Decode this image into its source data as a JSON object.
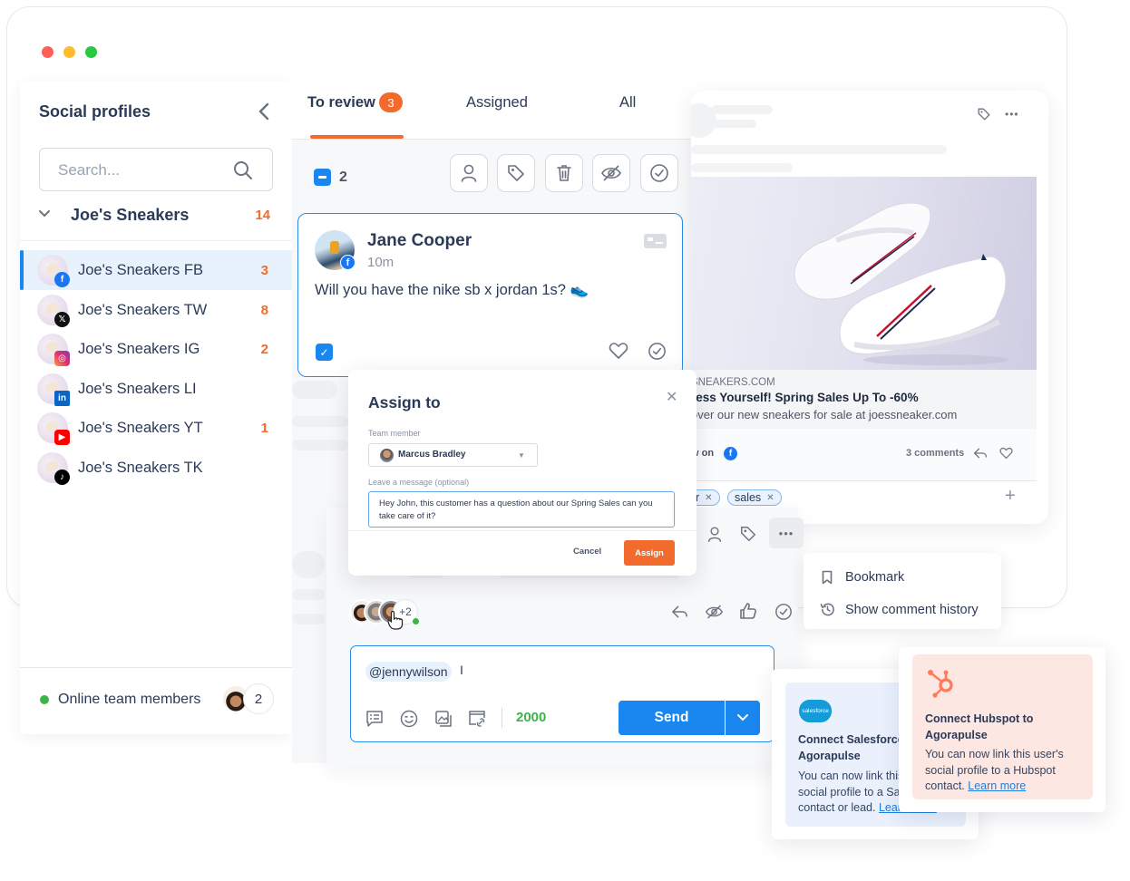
{
  "window": {
    "controls": [
      {
        "name": "close",
        "color": "#ff5f57"
      },
      {
        "name": "minimize",
        "color": "#febc2e"
      },
      {
        "name": "maximize",
        "color": "#28c840"
      }
    ]
  },
  "sidebar": {
    "title": "Social profiles",
    "search_placeholder": "Search...",
    "group": {
      "name": "Joe's Sneakers",
      "count": "14"
    },
    "profiles": [
      {
        "name": "Joe's Sneakers FB",
        "network": "facebook",
        "count": "3",
        "active": true
      },
      {
        "name": "Joe's Sneakers TW",
        "network": "x",
        "count": "8",
        "active": false
      },
      {
        "name": "Joe's Sneakers IG",
        "network": "instagram",
        "count": "2",
        "active": false
      },
      {
        "name": "Joe's Sneakers LI",
        "network": "linkedin",
        "count": "",
        "active": false
      },
      {
        "name": "Joe's Sneakers YT",
        "network": "youtube",
        "count": "1",
        "active": false
      },
      {
        "name": "Joe's Sneakers TK",
        "network": "tiktok",
        "count": "",
        "active": false
      }
    ],
    "online": {
      "label": "Online team members",
      "count": "2"
    }
  },
  "inbox": {
    "tabs": [
      {
        "label": "To review",
        "badge": "3",
        "active": true
      },
      {
        "label": "Assigned",
        "active": false
      },
      {
        "label": "All",
        "active": false
      }
    ],
    "selected_count": "2",
    "toolbar": [
      "assign-user",
      "tag",
      "delete",
      "hide",
      "mark-reviewed"
    ],
    "card": {
      "author": "Jane Cooper",
      "time": "10m",
      "network": "facebook",
      "message": "Will you have the nike sb x jordan 1s? 👟",
      "checked": true
    }
  },
  "post": {
    "domain": "JOESSNEAKERS.COM",
    "domain_visible": "SNEAKERS.COM",
    "headline_visible": "ress Yourself! Spring Sales Up To -60%",
    "description_visible": "over our new sneakers for sale at joessneaker.com",
    "view_on_visible": "w on",
    "comments": "3 comments",
    "tags": [
      {
        "label": "er"
      },
      {
        "label": "sales"
      }
    ]
  },
  "assign_modal": {
    "title": "Assign to",
    "team_member_label": "Team member",
    "team_member_value": "Marcus Bradley",
    "message_label": "Leave a message (optional)",
    "message_value": "Hey John, this customer has a question about our Spring Sales can you take care of it?",
    "cancel_label": "Cancel",
    "assign_label": "Assign"
  },
  "comment": {
    "avatars_extra": "+2",
    "reply_mention": "@jennywilson",
    "reply_cursor": "I",
    "char_count": "2000",
    "send_label": "Send"
  },
  "more_menu": {
    "items": [
      {
        "label": "Bookmark",
        "icon": "bookmark-icon"
      },
      {
        "label": "Show comment history",
        "icon": "history-icon"
      }
    ]
  },
  "integrations": {
    "salesforce": {
      "logo_text": "salesforce",
      "title_line1": "Connect Salesforce to",
      "title_line2": "Agorapulse",
      "body_line1": "You can now link this user's",
      "body_line2": "social profile to a Salesforce",
      "body_line3": "contact or lead.",
      "link": "Learn more"
    },
    "hubspot": {
      "title_line1": "Connect Hubspot to",
      "title_line2": "Agorapulse",
      "body_line1": "You can now link this user's",
      "body_line2": "social profile to a Hubspot",
      "body_line3": "contact.",
      "link": "Learn more"
    }
  },
  "colors": {
    "accent": "#1a86f0",
    "brand_orange": "#f26b2d",
    "success": "#3bb54a",
    "text": "#2b3a57"
  }
}
